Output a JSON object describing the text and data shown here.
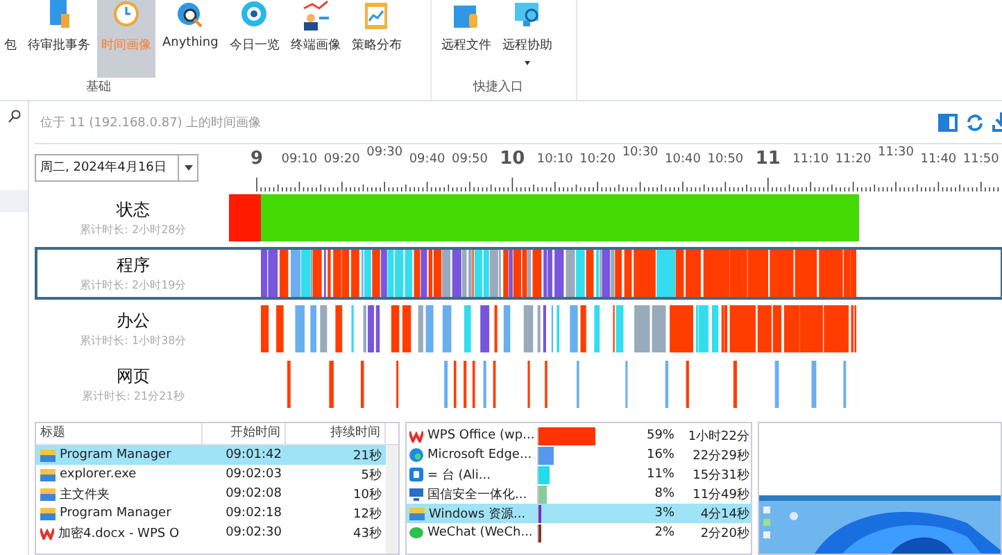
{
  "ribbon": {
    "buttons": [
      {
        "label": "包",
        "selected": false
      },
      {
        "label": "待审批事务",
        "selected": false
      },
      {
        "label": "时间画像",
        "selected": true
      },
      {
        "label": "Anything",
        "selected": false
      },
      {
        "label": "今日一览",
        "selected": false
      },
      {
        "label": "终端画像",
        "selected": false
      },
      {
        "label": "策略分布",
        "selected": false
      },
      {
        "label": "远程文件",
        "selected": false
      },
      {
        "label": "远程协助",
        "selected": false
      }
    ],
    "groups": [
      "基础",
      "快捷入口"
    ]
  },
  "header": {
    "title": "位于 11 (192.168.0.87) 上的时间画像"
  },
  "date_select": {
    "value": "周二, 2024年4月16日"
  },
  "axis_labels": [
    {
      "label": "9",
      "kind": "hour"
    },
    {
      "label": "09:10",
      "kind": "minute"
    },
    {
      "label": "09:20",
      "kind": "minute"
    },
    {
      "label": "09:30",
      "kind": "half"
    },
    {
      "label": "09:40",
      "kind": "minute"
    },
    {
      "label": "09:50",
      "kind": "minute"
    },
    {
      "label": "10",
      "kind": "hour"
    },
    {
      "label": "10:10",
      "kind": "minute"
    },
    {
      "label": "10:20",
      "kind": "minute"
    },
    {
      "label": "10:30",
      "kind": "half"
    },
    {
      "label": "10:40",
      "kind": "minute"
    },
    {
      "label": "10:50",
      "kind": "minute"
    },
    {
      "label": "11",
      "kind": "hour"
    },
    {
      "label": "11:10",
      "kind": "minute"
    },
    {
      "label": "11:20",
      "kind": "minute"
    },
    {
      "label": "11:30",
      "kind": "half"
    },
    {
      "label": "11:40",
      "kind": "minute"
    },
    {
      "label": "11:50",
      "kind": "minute"
    }
  ],
  "rows": [
    {
      "label": "状态",
      "total": "累计时长: 2小时28分",
      "selected": false,
      "kind": "status"
    },
    {
      "label": "程序",
      "total": "累计时长: 2小时19分",
      "selected": true,
      "kind": "dense"
    },
    {
      "label": "办公",
      "total": "累计时长: 1小时38分",
      "selected": false,
      "kind": "office"
    },
    {
      "label": "网页",
      "total": "累计时长: 21分21秒",
      "selected": false,
      "kind": "sparse"
    }
  ],
  "window_table": {
    "columns": [
      "标题",
      "开始时间",
      "持续时间"
    ],
    "rows": [
      {
        "kind": "folder",
        "title": "Program Manager",
        "start": "09:01:42",
        "duration": "21秒",
        "selected": true
      },
      {
        "kind": "folder",
        "title": "explorer.exe",
        "start": "09:02:03",
        "duration": "5秒",
        "selected": false
      },
      {
        "kind": "folder",
        "title": "主文件夹",
        "start": "09:02:08",
        "duration": "10秒",
        "selected": false
      },
      {
        "kind": "folder",
        "title": "Program Manager",
        "start": "09:02:18",
        "duration": "12秒",
        "selected": false
      },
      {
        "kind": "wps",
        "title": "加密4.docx - WPS O",
        "start": "09:02:30",
        "duration": "43秒",
        "selected": false
      }
    ]
  },
  "app_usage": [
    {
      "kind": "wps",
      "name": "WPS Office (wp...",
      "level": 0.59,
      "percent": "59%",
      "duration": "1小时22分",
      "color": "#ff3300",
      "selected": false
    },
    {
      "kind": "edge",
      "name": "Microsoft Edge...",
      "level": 0.16,
      "percent": "16%",
      "duration": "22分29秒",
      "color": "#5599ee",
      "selected": false
    },
    {
      "kind": "app",
      "name": "= 台 (Ali...",
      "level": 0.11,
      "percent": "11%",
      "duration": "15分31秒",
      "color": "#22ddee",
      "selected": false
    },
    {
      "kind": "monitor",
      "name": "国信安全一体化...",
      "level": 0.08,
      "percent": "8%",
      "duration": "11分49秒",
      "color": "#88cc99",
      "selected": false
    },
    {
      "kind": "folder",
      "name": "Windows 资源...",
      "level": 0.03,
      "percent": "3%",
      "duration": "4分14秒",
      "color": "#6633cc",
      "selected": true
    },
    {
      "kind": "wechat",
      "name": "WeChat (WeCh...",
      "level": 0.02,
      "percent": "2%",
      "duration": "2分20秒",
      "color": "#883322",
      "selected": false
    }
  ]
}
